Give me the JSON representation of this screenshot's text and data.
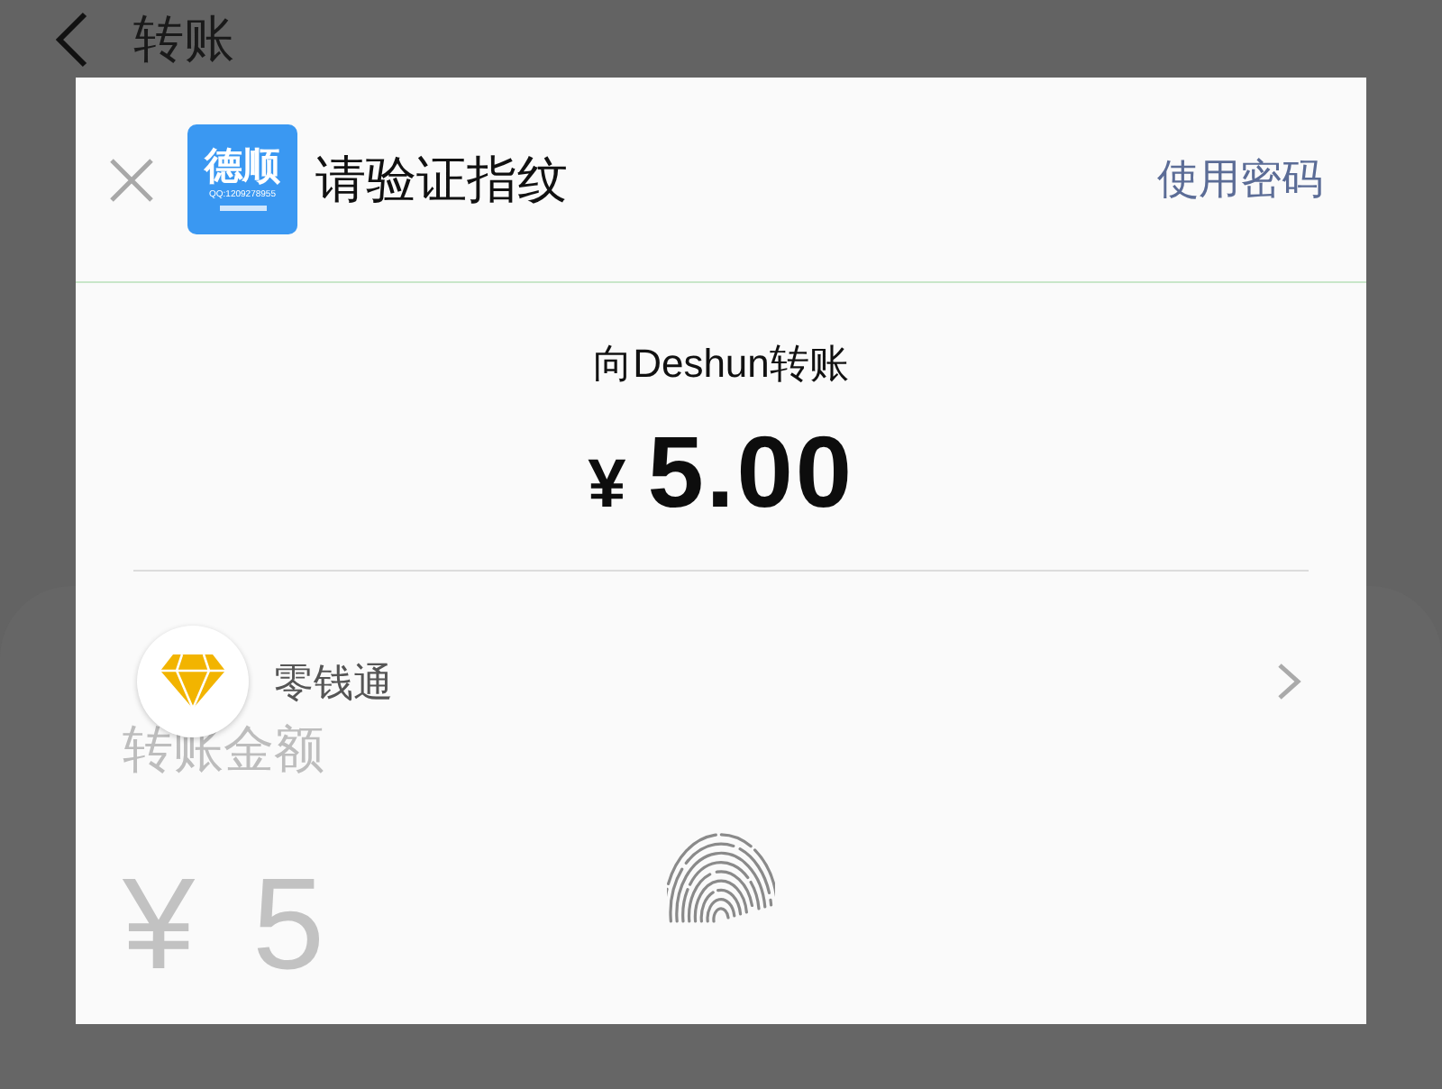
{
  "page": {
    "title": "转账",
    "amount_label": "转账金额",
    "amount_currency": "¥",
    "amount_value": "5"
  },
  "dialog": {
    "title": "请验证指纹",
    "logo": {
      "name": "德顺",
      "contact": "QQ:1209278955"
    },
    "alt_action": "使用密码",
    "payee": "向Deshun转账",
    "currency": "¥",
    "amount": "5.00",
    "payment_method": {
      "label": "零钱通"
    }
  }
}
